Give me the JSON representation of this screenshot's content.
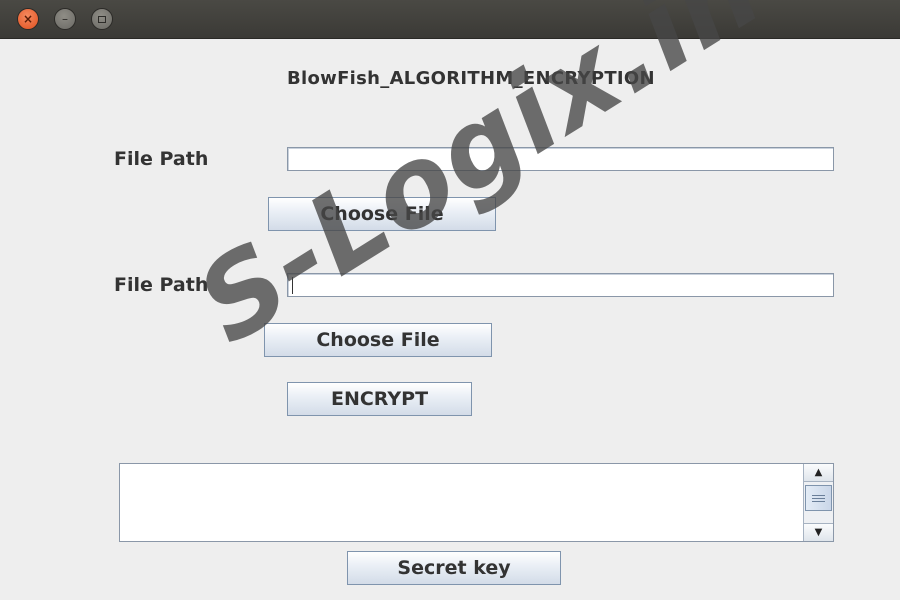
{
  "window": {
    "close_glyph": "×",
    "minimize_glyph": "–"
  },
  "app_title": "BlowFish_ALGORITHM_ENCRYPTION",
  "form": {
    "file_path_label_1": "File Path",
    "file_path_value_1": "",
    "choose_file_label_1": "Choose File",
    "file_path_label_2": "File Path",
    "file_path_value_2": "",
    "choose_file_label_2": "Choose File",
    "encrypt_label": "ENCRYPT",
    "output_text": "",
    "secret_key_label": "Secret key"
  },
  "scrollbar": {
    "up_glyph": "▲",
    "down_glyph": "▼"
  },
  "watermark": "S-Logix.in",
  "colors": {
    "titlebar": "#3b3a36",
    "close_button": "#e0501f",
    "background": "#eeeeee",
    "button_border": "#7f94ad"
  },
  "icons": {
    "close": "close-icon",
    "minimize": "minimize-icon",
    "maximize": "maximize-icon",
    "scroll_up": "arrow-up-icon",
    "scroll_down": "arrow-down-icon"
  }
}
